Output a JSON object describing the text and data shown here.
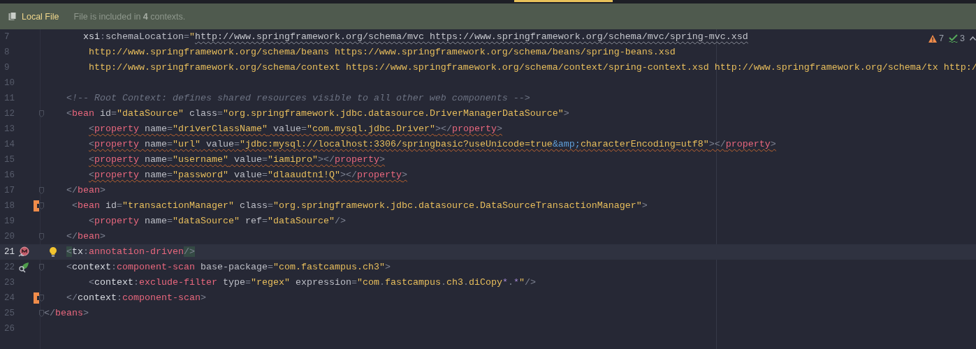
{
  "editor_tabs": [
    {
      "selected": true
    }
  ],
  "banner": {
    "label": "Local File",
    "message": "File is included in **4** contexts."
  },
  "inspections": {
    "warnings": "7",
    "weak_warnings": "3"
  },
  "lines": [
    {
      "number": "7",
      "current": false,
      "tokens": [
        {
          "kind": "ns",
          "text": "       xsi"
        },
        {
          "kind": "p",
          "text": ":"
        },
        {
          "kind": "attr",
          "text": "schemaLocation"
        },
        {
          "kind": "p",
          "text": "="
        },
        {
          "kind": "str",
          "text": "\""
        },
        {
          "kind": "url",
          "text": "http://www.springframework.org/schema/mvc https://www.springframework.org/schema/mvc/spring-mvc.xsd",
          "weak_warning": true
        }
      ]
    },
    {
      "number": "8",
      "current": false,
      "tokens": [
        {
          "kind": "str",
          "text": "        http://www.springframework.org/schema/beans https://www.springframework.org/schema/beans/spring-beans.xsd"
        }
      ]
    },
    {
      "number": "9",
      "current": false,
      "tokens": [
        {
          "kind": "str",
          "text": "        http://www.springframework.org/schema/context https://www.springframework.org/schema/context/spring-context.xsd http://www.springframework.org/schema/tx http:/"
        }
      ]
    },
    {
      "number": "10",
      "current": false
    },
    {
      "number": "11",
      "current": false,
      "tokens": [
        {
          "kind": "cm",
          "text": "    <!-- Root Context: defines shared resources visible to all other web components -->"
        }
      ]
    },
    {
      "number": "12",
      "current": false,
      "fold": true,
      "tokens": [
        {
          "kind": "p",
          "text": "    <"
        },
        {
          "kind": "tag",
          "text": "bean"
        },
        {
          "kind": "attr",
          "text": " id"
        },
        {
          "kind": "p",
          "text": "="
        },
        {
          "kind": "str",
          "text": "\"dataSource\""
        },
        {
          "kind": "attr",
          "text": " class"
        },
        {
          "kind": "p",
          "text": "="
        },
        {
          "kind": "str",
          "text": "\"org.springframework.jdbc.datasource.DriverManagerDataSource\""
        },
        {
          "kind": "p",
          "text": ">"
        }
      ]
    },
    {
      "number": "13",
      "current": false,
      "tokens": [
        {
          "kind": "p",
          "text": "        <",
          "warning": true
        },
        {
          "kind": "tag",
          "text": "property",
          "warning": true
        },
        {
          "kind": "attr",
          "text": " name",
          "warning": true
        },
        {
          "kind": "p",
          "text": "=",
          "warning": true
        },
        {
          "kind": "str",
          "text": "\"driverClassName\"",
          "warning": true
        },
        {
          "kind": "attr",
          "text": " value",
          "warning": true
        },
        {
          "kind": "p",
          "text": "=",
          "warning": true
        },
        {
          "kind": "str",
          "text": "\"com.mysql.jdbc.Driver\"",
          "warning": true
        },
        {
          "kind": "p",
          "text": "></",
          "warning": true
        },
        {
          "kind": "tag",
          "text": "property",
          "warning": true
        },
        {
          "kind": "p",
          "text": ">",
          "warning": true
        }
      ]
    },
    {
      "number": "14",
      "current": false,
      "tokens": [
        {
          "kind": "p",
          "text": "        <",
          "warning": true
        },
        {
          "kind": "tag",
          "text": "property",
          "warning": true
        },
        {
          "kind": "attr",
          "text": " name",
          "warning": true
        },
        {
          "kind": "p",
          "text": "=",
          "warning": true
        },
        {
          "kind": "str",
          "text": "\"url\"",
          "warning": true
        },
        {
          "kind": "attr",
          "text": " value",
          "warning": true
        },
        {
          "kind": "p",
          "text": "=",
          "warning": true
        },
        {
          "kind": "str",
          "text": "\"jdbc:mysql://localhost:3306/springbasic?useUnicode=true",
          "warning": true
        },
        {
          "kind": "ent",
          "text": "&amp;",
          "warning": true
        },
        {
          "kind": "str",
          "text": "characterEncoding=utf8\"",
          "warning": true
        },
        {
          "kind": "p",
          "text": "></",
          "warning": true
        },
        {
          "kind": "tag",
          "text": "property",
          "warning": true
        },
        {
          "kind": "p",
          "text": ">",
          "warning": true
        }
      ]
    },
    {
      "number": "15",
      "current": false,
      "tokens": [
        {
          "kind": "p",
          "text": "        <",
          "warning": true
        },
        {
          "kind": "tag",
          "text": "property",
          "warning": true
        },
        {
          "kind": "attr",
          "text": " name",
          "warning": true
        },
        {
          "kind": "p",
          "text": "=",
          "warning": true
        },
        {
          "kind": "str",
          "text": "\"username\"",
          "warning": true
        },
        {
          "kind": "attr",
          "text": " value",
          "warning": true
        },
        {
          "kind": "p",
          "text": "=",
          "warning": true
        },
        {
          "kind": "str",
          "text": "\"iamipro\"",
          "warning": true
        },
        {
          "kind": "p",
          "text": "></",
          "warning": true
        },
        {
          "kind": "tag",
          "text": "property",
          "warning": true
        },
        {
          "kind": "p",
          "text": ">",
          "warning": true
        }
      ]
    },
    {
      "number": "16",
      "current": false,
      "tokens": [
        {
          "kind": "p",
          "text": "        <",
          "warning": true
        },
        {
          "kind": "tag",
          "text": "property",
          "warning": true
        },
        {
          "kind": "attr",
          "text": " name",
          "warning": true
        },
        {
          "kind": "p",
          "text": "=",
          "warning": true
        },
        {
          "kind": "str",
          "text": "\"password\"",
          "warning": true
        },
        {
          "kind": "attr",
          "text": " value",
          "warning": true
        },
        {
          "kind": "p",
          "text": "=",
          "warning": true
        },
        {
          "kind": "str",
          "text": "\"dlaaudtn1!Q\"",
          "warning": true
        },
        {
          "kind": "p",
          "text": "></",
          "warning": true
        },
        {
          "kind": "tag",
          "text": "property",
          "warning": true
        },
        {
          "kind": "p",
          "text": ">",
          "warning": true
        }
      ]
    },
    {
      "number": "17",
      "current": false,
      "fold": true,
      "tokens": [
        {
          "kind": "p",
          "text": "    </"
        },
        {
          "kind": "tag",
          "text": "bean"
        },
        {
          "kind": "p",
          "text": ">"
        }
      ]
    },
    {
      "number": "18",
      "current": false,
      "changed": true,
      "fold": true,
      "tokens": [
        {
          "kind": "p",
          "text": "     <"
        },
        {
          "kind": "tag",
          "text": "bean"
        },
        {
          "kind": "attr",
          "text": " id"
        },
        {
          "kind": "p",
          "text": "="
        },
        {
          "kind": "str",
          "text": "\"transactionManager\""
        },
        {
          "kind": "attr",
          "text": " class"
        },
        {
          "kind": "p",
          "text": "="
        },
        {
          "kind": "str",
          "text": "\"org.springframework.jdbc.datasource.DataSourceTransactionManager\""
        },
        {
          "kind": "p",
          "text": ">"
        }
      ]
    },
    {
      "number": "19",
      "current": false,
      "tokens": [
        {
          "kind": "p",
          "text": "        <"
        },
        {
          "kind": "tag",
          "text": "property"
        },
        {
          "kind": "attr",
          "text": " name"
        },
        {
          "kind": "p",
          "text": "="
        },
        {
          "kind": "str",
          "text": "\"dataSource\""
        },
        {
          "kind": "attr",
          "text": " ref"
        },
        {
          "kind": "p",
          "text": "="
        },
        {
          "kind": "str",
          "text": "\"dataSource\""
        },
        {
          "kind": "p",
          "text": "/>"
        }
      ]
    },
    {
      "number": "20",
      "current": false,
      "fold": true,
      "tokens": [
        {
          "kind": "p",
          "text": "    </"
        },
        {
          "kind": "tag",
          "text": "bean"
        },
        {
          "kind": "p",
          "text": ">"
        }
      ]
    },
    {
      "number": "21",
      "current": true,
      "gutter_icon": {
        "kind": "bean"
      },
      "intention_bulb": true,
      "tokens": [
        {
          "kind": "match",
          "text": "    <"
        },
        {
          "kind": "ns",
          "text": "tx"
        },
        {
          "kind": "p",
          "text": ":"
        },
        {
          "kind": "tag",
          "text": "annotation-driven"
        },
        {
          "kind": "match",
          "text": "/>"
        }
      ]
    },
    {
      "number": "22",
      "current": false,
      "gutter_icon": {
        "kind": "leaf"
      },
      "fold": true,
      "tokens": [
        {
          "kind": "p",
          "text": "    <"
        },
        {
          "kind": "ns",
          "text": "context"
        },
        {
          "kind": "p",
          "text": ":"
        },
        {
          "kind": "tag",
          "text": "component-scan"
        },
        {
          "kind": "attr",
          "text": " base-package"
        },
        {
          "kind": "p",
          "text": "="
        },
        {
          "kind": "str",
          "text": "\"com.fastcampus.ch3\""
        },
        {
          "kind": "p",
          "text": ">"
        }
      ]
    },
    {
      "number": "23",
      "current": false,
      "tokens": [
        {
          "kind": "p",
          "text": "        <"
        },
        {
          "kind": "ns",
          "text": "context"
        },
        {
          "kind": "p",
          "text": ":"
        },
        {
          "kind": "tag",
          "text": "exclude-filter"
        },
        {
          "kind": "attr",
          "text": " type"
        },
        {
          "kind": "p",
          "text": "="
        },
        {
          "kind": "str",
          "text": "\"regex\""
        },
        {
          "kind": "attr",
          "text": " expression"
        },
        {
          "kind": "p",
          "text": "="
        },
        {
          "kind": "str",
          "text": "\"com"
        },
        {
          "kind": "p",
          "text": "."
        },
        {
          "kind": "str",
          "text": "fastcampus"
        },
        {
          "kind": "p",
          "text": "."
        },
        {
          "kind": "str",
          "text": "ch3"
        },
        {
          "kind": "p",
          "text": "."
        },
        {
          "kind": "str",
          "text": "diCopy"
        },
        {
          "kind": "rx",
          "text": "*"
        },
        {
          "kind": "p",
          "text": "."
        },
        {
          "kind": "rx",
          "text": "*"
        },
        {
          "kind": "str",
          "text": "\""
        },
        {
          "kind": "p",
          "text": "/>"
        }
      ]
    },
    {
      "number": "24",
      "current": false,
      "changed": true,
      "fold": true,
      "tokens": [
        {
          "kind": "p",
          "text": "    </"
        },
        {
          "kind": "ns",
          "text": "context"
        },
        {
          "kind": "p",
          "text": ":"
        },
        {
          "kind": "tag",
          "text": "component-scan"
        },
        {
          "kind": "p",
          "text": ">"
        }
      ]
    },
    {
      "number": "25",
      "current": false,
      "fold": true,
      "tokens": [
        {
          "kind": "p",
          "text": "</"
        },
        {
          "kind": "tag",
          "text": "beans"
        },
        {
          "kind": "p",
          "text": ">"
        }
      ]
    },
    {
      "number": "26",
      "current": false
    }
  ]
}
